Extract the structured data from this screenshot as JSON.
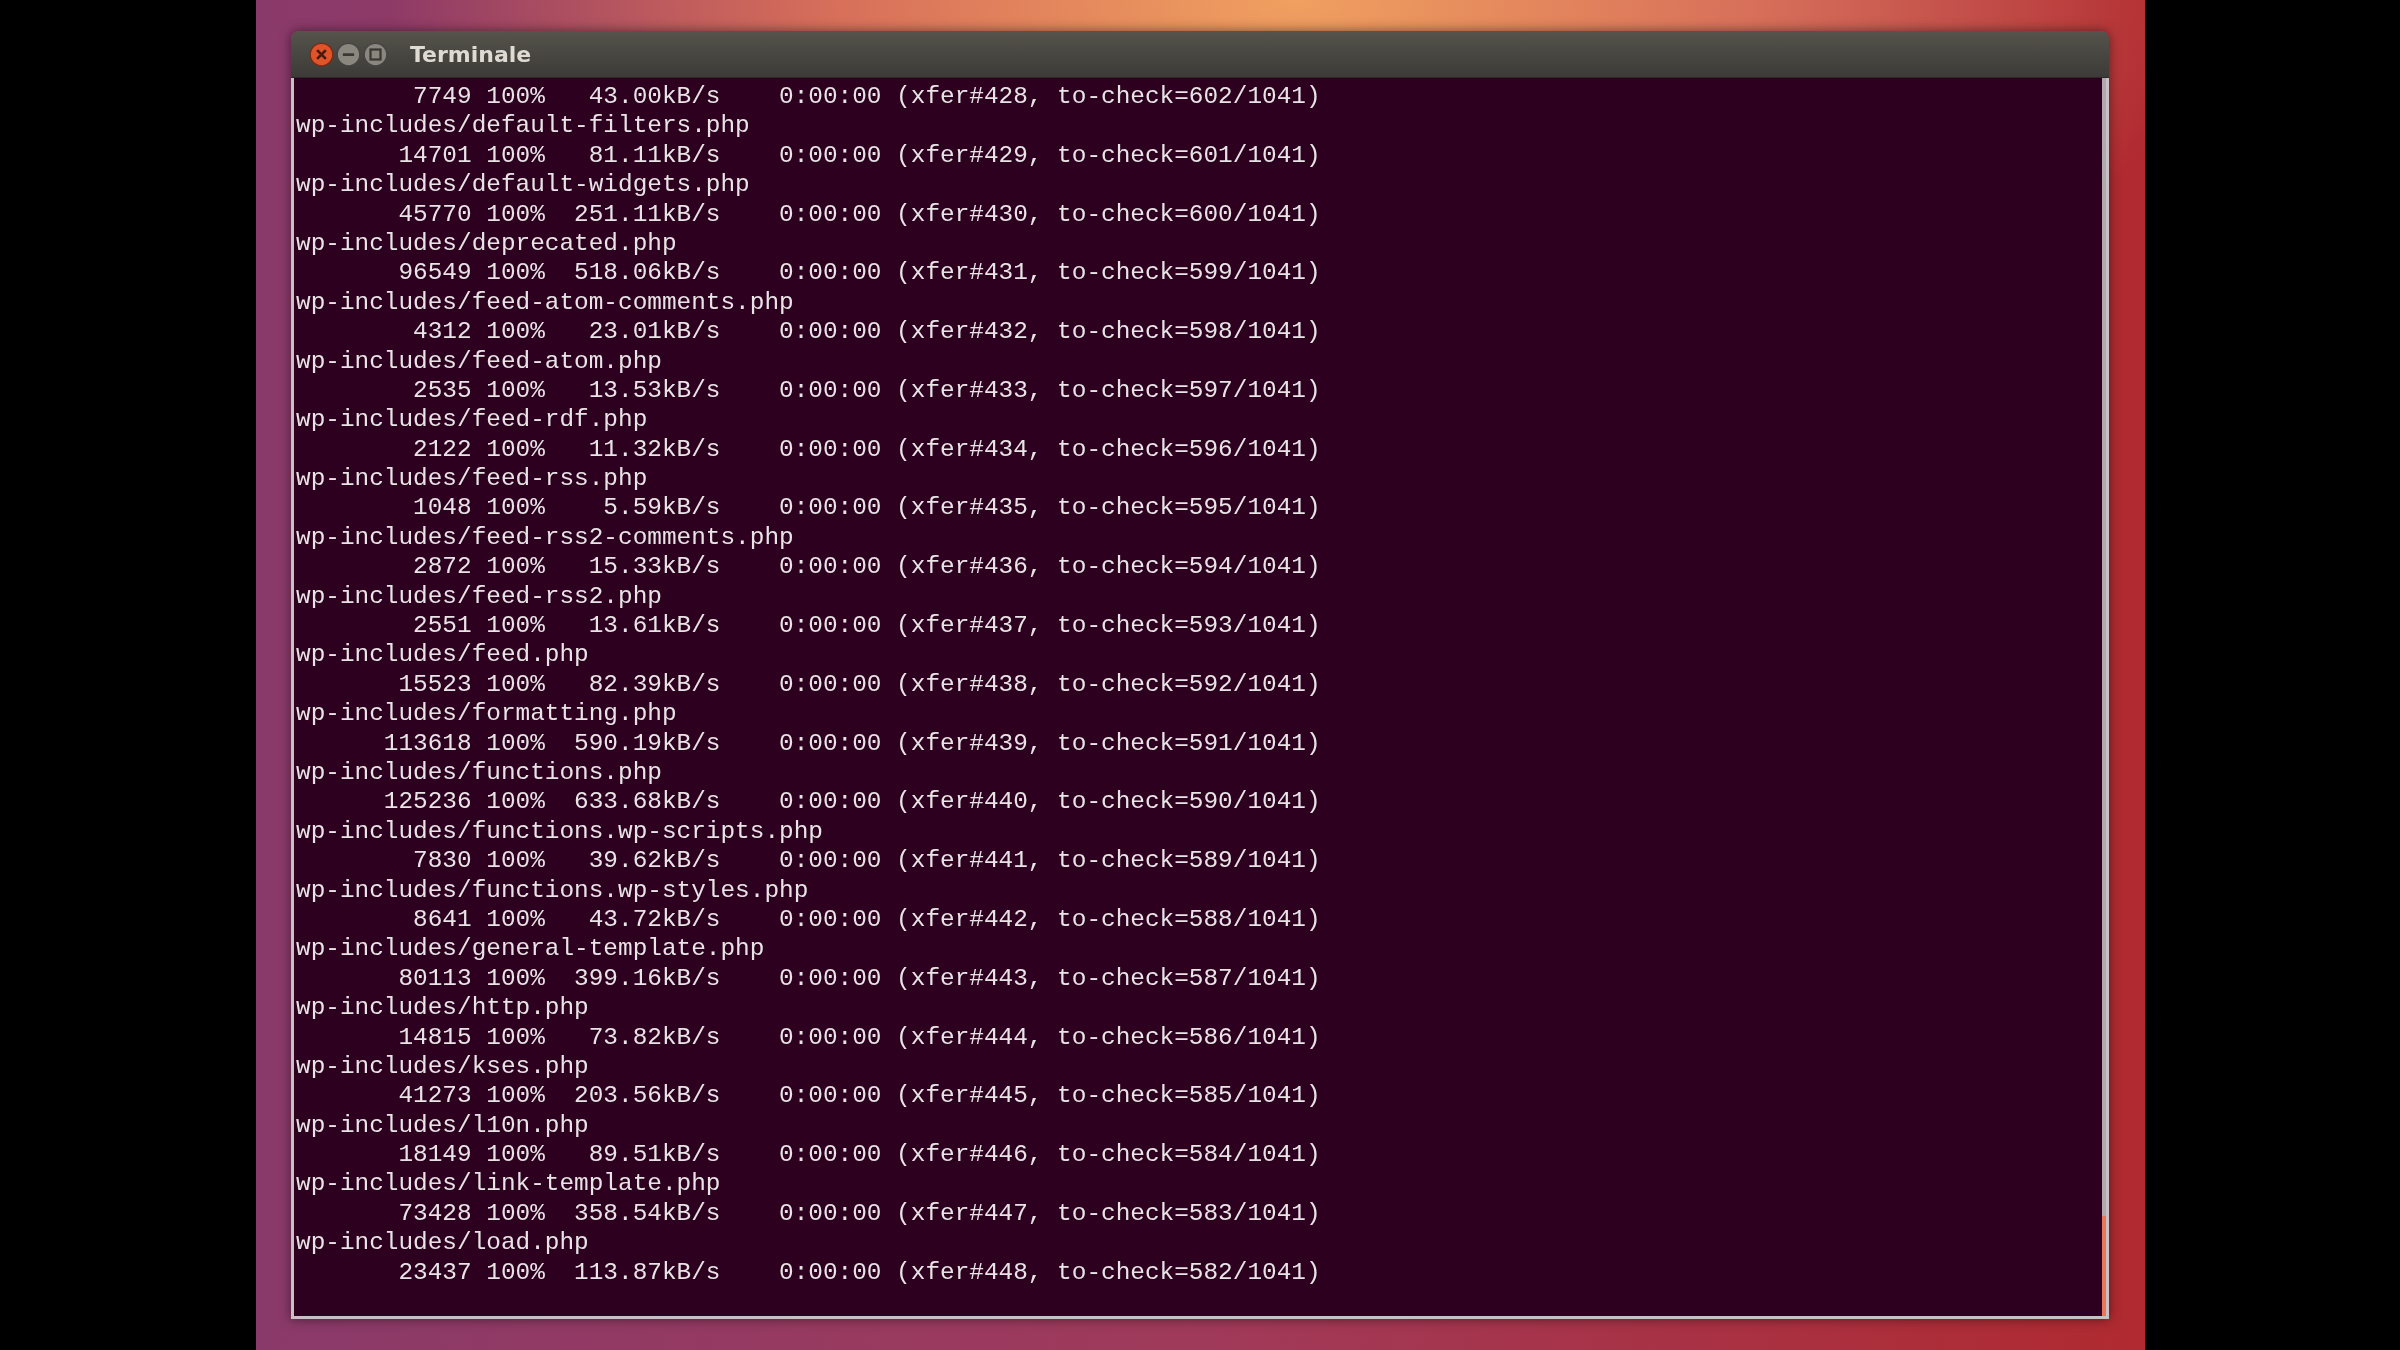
{
  "window": {
    "title": "Terminale"
  },
  "terminal": {
    "lines": [
      "        7749 100%   43.00kB/s    0:00:00 (xfer#428, to-check=602/1041)",
      "wp-includes/default-filters.php",
      "       14701 100%   81.11kB/s    0:00:00 (xfer#429, to-check=601/1041)",
      "wp-includes/default-widgets.php",
      "       45770 100%  251.11kB/s    0:00:00 (xfer#430, to-check=600/1041)",
      "wp-includes/deprecated.php",
      "       96549 100%  518.06kB/s    0:00:00 (xfer#431, to-check=599/1041)",
      "wp-includes/feed-atom-comments.php",
      "        4312 100%   23.01kB/s    0:00:00 (xfer#432, to-check=598/1041)",
      "wp-includes/feed-atom.php",
      "        2535 100%   13.53kB/s    0:00:00 (xfer#433, to-check=597/1041)",
      "wp-includes/feed-rdf.php",
      "        2122 100%   11.32kB/s    0:00:00 (xfer#434, to-check=596/1041)",
      "wp-includes/feed-rss.php",
      "        1048 100%    5.59kB/s    0:00:00 (xfer#435, to-check=595/1041)",
      "wp-includes/feed-rss2-comments.php",
      "        2872 100%   15.33kB/s    0:00:00 (xfer#436, to-check=594/1041)",
      "wp-includes/feed-rss2.php",
      "        2551 100%   13.61kB/s    0:00:00 (xfer#437, to-check=593/1041)",
      "wp-includes/feed.php",
      "       15523 100%   82.39kB/s    0:00:00 (xfer#438, to-check=592/1041)",
      "wp-includes/formatting.php",
      "      113618 100%  590.19kB/s    0:00:00 (xfer#439, to-check=591/1041)",
      "wp-includes/functions.php",
      "      125236 100%  633.68kB/s    0:00:00 (xfer#440, to-check=590/1041)",
      "wp-includes/functions.wp-scripts.php",
      "        7830 100%   39.62kB/s    0:00:00 (xfer#441, to-check=589/1041)",
      "wp-includes/functions.wp-styles.php",
      "        8641 100%   43.72kB/s    0:00:00 (xfer#442, to-check=588/1041)",
      "wp-includes/general-template.php",
      "       80113 100%  399.16kB/s    0:00:00 (xfer#443, to-check=587/1041)",
      "wp-includes/http.php",
      "       14815 100%   73.82kB/s    0:00:00 (xfer#444, to-check=586/1041)",
      "wp-includes/kses.php",
      "       41273 100%  203.56kB/s    0:00:00 (xfer#445, to-check=585/1041)",
      "wp-includes/l10n.php",
      "       18149 100%   89.51kB/s    0:00:00 (xfer#446, to-check=584/1041)",
      "wp-includes/link-template.php",
      "       73428 100%  358.54kB/s    0:00:00 (xfer#447, to-check=583/1041)",
      "wp-includes/load.php",
      "       23437 100%  113.87kB/s    0:00:00 (xfer#448, to-check=582/1041)"
    ]
  }
}
